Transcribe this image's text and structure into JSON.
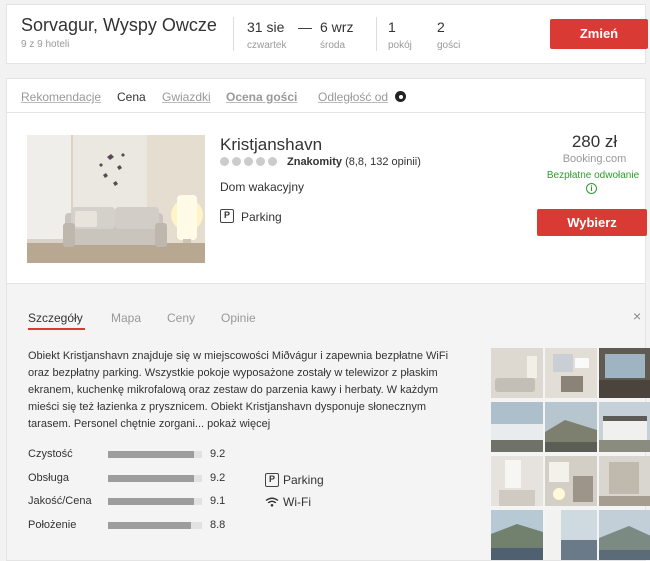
{
  "search": {
    "destination": "Sorvagur, Wyspy Owcze",
    "hotel_count": "9 z 9 hoteli",
    "checkin_date": "31 sie",
    "checkin_day": "czwartek",
    "dash": "—",
    "checkout_date": "6 wrz",
    "checkout_day": "środa",
    "rooms_value": "1",
    "rooms_label": "pokój",
    "guests_value": "2",
    "guests_label": "gości",
    "change_button": "Zmień"
  },
  "sort": {
    "items": [
      "Rekomendacje",
      "Cena",
      "Gwiazdki",
      "Ocena gości",
      "Odległość od"
    ]
  },
  "hotel": {
    "name": "Kristjanshavn",
    "rating_word": "Znakomity",
    "rating_detail": "(8,8, 132 opinii)",
    "type": "Dom wakacyjny",
    "facility": "Parking",
    "price": "280 zł",
    "source": "Booking.com",
    "cancellation": "Bezpłatne odwołanie",
    "choose_button": "Wybierz"
  },
  "details": {
    "tabs": [
      "Szczegóły",
      "Mapa",
      "Ceny",
      "Opinie"
    ],
    "close": "×",
    "description": "Obiekt Kristjanshavn znajduje się w miejscowości Miðvágur i zapewnia bezpłatne WiFi oraz bezpłatny parking. Wszystkie pokoje wyposażone zostały w telewizor z płaskim ekranem, kuchenkę mikrofalową oraz zestaw do parzenia kawy i herbaty. W każdym mieści się też łazienka z prysznicem. Obiekt Kristjanshavn dysponuje słonecznym tarasem. Personel chętnie zorgani...",
    "more_link": "pokaż więcej",
    "scores": [
      {
        "label": "Czystość",
        "value": "9.2",
        "fraction": 0.92
      },
      {
        "label": "Obsługa",
        "value": "9.2",
        "fraction": 0.92
      },
      {
        "label": "Jakość/Cena",
        "value": "9.1",
        "fraction": 0.91
      },
      {
        "label": "Położenie",
        "value": "8.8",
        "fraction": 0.88
      }
    ],
    "amenities": [
      "Parking",
      "Wi-Fi"
    ]
  },
  "colors": {
    "accent": "#d93b34",
    "free_cancel": "#2c9e2c"
  }
}
